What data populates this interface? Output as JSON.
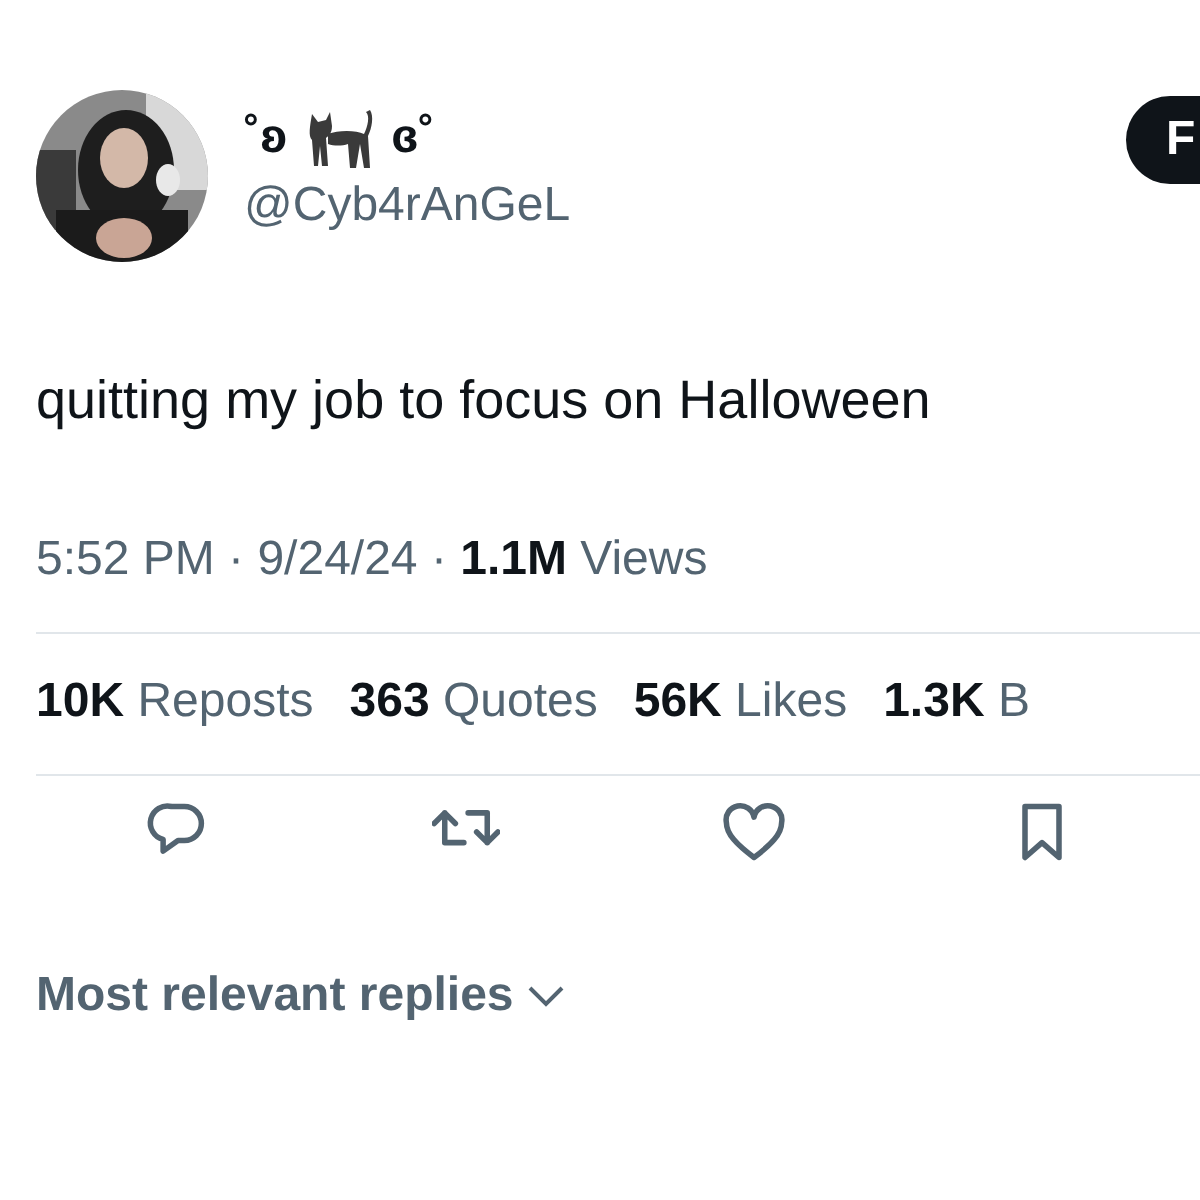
{
  "author": {
    "name_start": "˚ʚ",
    "name_end": "ɞ˚",
    "handle": "@Cyb4rAnGeL"
  },
  "follow_button": {
    "label": "F"
  },
  "tweet": {
    "text": "quitting my job to focus on Halloween"
  },
  "meta": {
    "line": "5:52 PM · 9/24/24 · **1.1M** Views"
  },
  "stats": [
    {
      "count": "10K",
      "label": "Reposts"
    },
    {
      "count": "363",
      "label": "Quotes"
    },
    {
      "count": "56K",
      "label": "Likes"
    },
    {
      "count": "1.3K",
      "label": "B"
    }
  ],
  "actions": [
    {
      "kind": "reply"
    },
    {
      "kind": "repost"
    },
    {
      "kind": "like"
    },
    {
      "kind": "bookmark"
    }
  ],
  "replies_sort": {
    "label": "Most relevant replies"
  }
}
